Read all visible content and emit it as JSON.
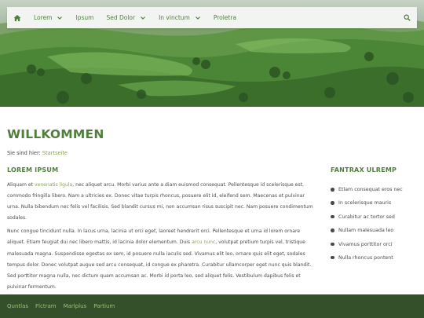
{
  "nav": {
    "items": [
      {
        "label": "Lorem",
        "dropdown": true
      },
      {
        "label": "Ipsum",
        "dropdown": false
      },
      {
        "label": "Sed Dolor",
        "dropdown": true
      },
      {
        "label": "In vinctum",
        "dropdown": true
      },
      {
        "label": "Proletra",
        "dropdown": false
      }
    ],
    "home_icon": "home-icon",
    "search_icon": "search-icon"
  },
  "page": {
    "title": "WILLKOMMEN",
    "breadcrumb_prefix": "Sie sind hier:",
    "breadcrumb_link": "Startseite"
  },
  "main": {
    "heading": "LOREM IPSUM",
    "p1_a": "Aliquam et ",
    "p1_link": "venenatis ligula",
    "p1_b": ", nec aliquet arcu. Morbi varius ante a diam euismod consequat. Pellentesque id scelerisque est, commodo fringilla libero. Nam a ultricies ex. Donec vitae turpis rhoncus, posuere elit id, eleifend sem. Maecenas et pulvinar urna. Nulla bibendum nec felis vel facilisis. Sed blandit cursus mi, non accumsan risus suscipit nec. Nam posuere condimentum sodales.",
    "p2_a": "Nunc congue tincidunt nulla. In lacus urna, lacinia ut orci eget, laoreet hendrerit orci. Pellentesque et urna id lorem ornare aliquet. Etiam feugiat dui nec libero mattis, id lacinia dolor elementum. Duis ",
    "p2_link": "arcu nunc",
    "p2_b": ", volutpat pretium turpis vel, tristique malesuada magna. Suspendisse egestas ex sem, id posuere nulla iaculis sed. Vivamus elit leo, ornare quis elit eget, sodales tempus dolor. Donec volutpat augue sed arcu consequat, id congue ex pharetra. Curabitur ullamcorper eget nunc quis blandit. Sed porttitor magna nulla, nec dictum quam accumsan ac. Morbi id porta leo, sed aliquet felis. Vestibulum dapibus felis et pulvinar fermentum."
  },
  "sidebar": {
    "heading": "FANTRAX ULREMP",
    "items": [
      "Etlam consequat eros nec",
      "In scelerisque mauris",
      "Curabitur ac tortor sed",
      "Nullam malesuada leo",
      "Vivamus porttitor orci",
      "Nulla rhoncus pontent"
    ]
  },
  "footer": {
    "links": [
      "Quntlas",
      "Flctram",
      "Marlplus",
      "Partium"
    ]
  },
  "colors": {
    "accent_green": "#4f7f3b",
    "link_olive": "#8aa05a",
    "footer_bg": "#34502b",
    "footer_link": "#9fc07a"
  }
}
